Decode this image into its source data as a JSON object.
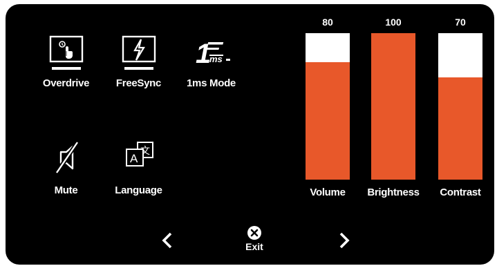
{
  "colors": {
    "accent": "#e8582a",
    "panel": "#000000",
    "track": "#ffffff",
    "text": "#ffffff"
  },
  "tiles": {
    "overdrive": {
      "label": "Overdrive",
      "icon": "monitor-touch-icon"
    },
    "freesync": {
      "label": "FreeSync",
      "icon": "monitor-lightning-icon"
    },
    "onems": {
      "label": "1ms Mode",
      "icon": "1ms-icon",
      "glyph_main": "1",
      "glyph_sub": "ms"
    },
    "mute": {
      "label": "Mute",
      "icon": "speaker-muted-icon"
    },
    "language": {
      "label": "Language",
      "icon": "translate-icon",
      "glyph_a": "A",
      "glyph_b": "文"
    }
  },
  "bars": [
    {
      "label": "Volume",
      "value": "80",
      "level": 80
    },
    {
      "label": "Brightness",
      "value": "100",
      "level": 100
    },
    {
      "label": "Contrast",
      "value": "70",
      "level": 70
    }
  ],
  "nav": {
    "prev_icon": "chevron-left-icon",
    "next_icon": "chevron-right-icon",
    "exit_icon": "close-circle-icon",
    "exit_label": "Exit"
  }
}
